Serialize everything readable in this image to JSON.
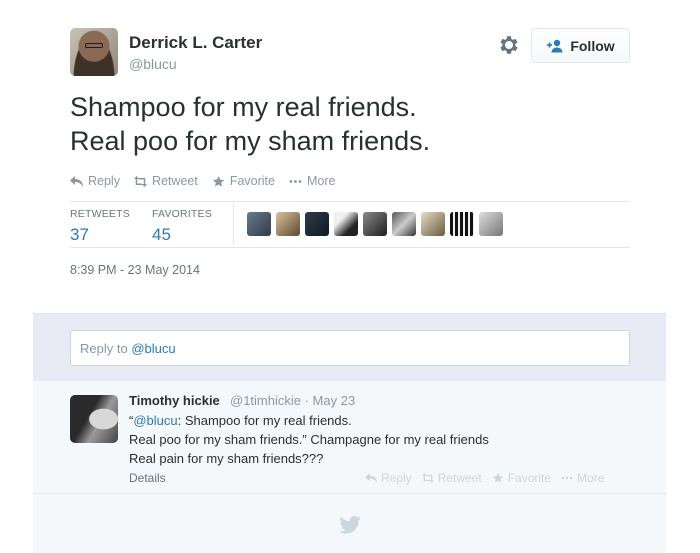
{
  "author": {
    "name": "Derrick L. Carter",
    "handle": "@blucu"
  },
  "header": {
    "settings_icon": "gear-icon",
    "follow_label": "Follow",
    "follow_icon": "add-person-icon"
  },
  "tweet": {
    "lines": [
      "Shampoo for my real friends.",
      "Real poo for my sham friends."
    ],
    "timestamp": "8:39 PM - 23 May 2014"
  },
  "actions": {
    "reply": "Reply",
    "retweet": "Retweet",
    "favorite": "Favorite",
    "more": "More"
  },
  "stats": {
    "retweets_label": "RETWEETS",
    "retweets_count": "37",
    "favorites_label": "FAVORITES",
    "favorites_count": "45"
  },
  "favoriters_count_shown": 9,
  "reply_box": {
    "prefix": "Reply to ",
    "mention": "@blucu"
  },
  "reply": {
    "name": "Timothy hickie",
    "meta": "@1timhickie · May 23",
    "line1_quote_open": "“",
    "line1_mention": "@blucu",
    "line1_rest": ": Shampoo for my real friends.",
    "line2": "Real poo for my sham friends.” Champagne for my real friends",
    "line3": "Real pain for my sham friends???",
    "details": "Details",
    "actions": {
      "reply": "Reply",
      "retweet": "Retweet",
      "favorite": "Favorite",
      "more": "More"
    }
  },
  "colors": {
    "link": "#2b7bb9",
    "muted": "#8899a6",
    "reply_zone_bg": "#e8eaf6"
  }
}
